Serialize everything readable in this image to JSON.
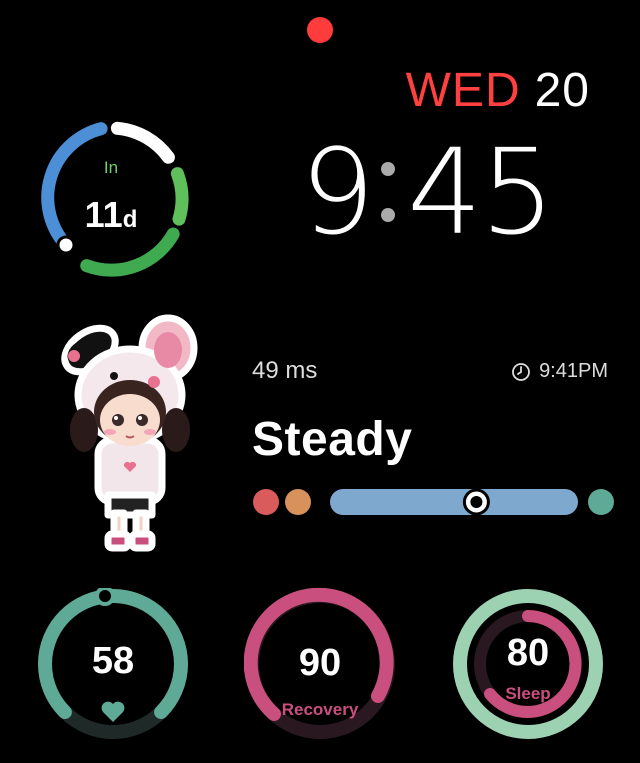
{
  "date": {
    "weekday": "WED",
    "day": "20"
  },
  "time": {
    "hours": "9",
    "minutes": "45"
  },
  "in_ring": {
    "label": "In",
    "value": "11",
    "unit": "d"
  },
  "hrv": {
    "value": "49 ms",
    "updated": "9:41PM",
    "status": "Steady",
    "level": 0.6
  },
  "complications": {
    "heart": {
      "value": "58",
      "icon": "heart-icon",
      "color": "#5fa997"
    },
    "recovery": {
      "value": "90",
      "label": "Recovery",
      "color": "#c94f7e"
    },
    "sleep": {
      "value": "80",
      "label": "Sleep",
      "color": "#c94f7e",
      "outer_color": "#9cd1b2"
    }
  },
  "colors": {
    "accent_red": "#ff4040",
    "ring_blue": "#4c8fd6",
    "ring_green": "#5fbf5a",
    "scale_red": "#d95b5b",
    "scale_orange": "#d9915b",
    "scale_blue": "#7fa8cf",
    "scale_green": "#5fa997"
  }
}
